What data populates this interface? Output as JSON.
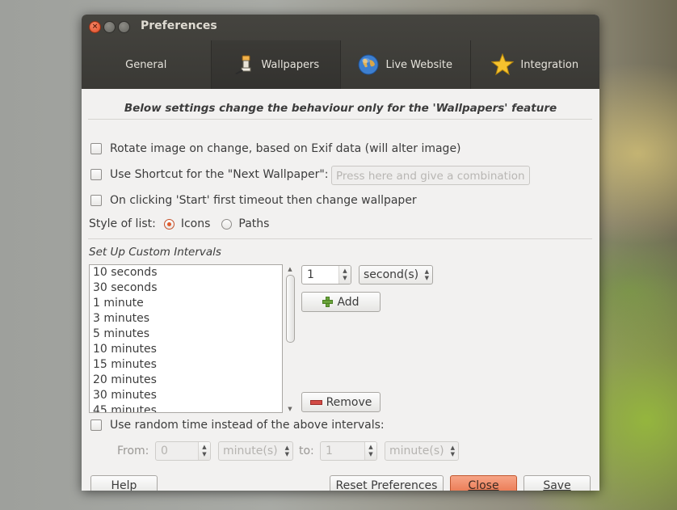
{
  "window": {
    "title": "Preferences"
  },
  "tabs": [
    {
      "label": "General",
      "icon": "none"
    },
    {
      "label": "Wallpapers",
      "icon": "paintbrush-icon"
    },
    {
      "label": "Live Website",
      "icon": "globe-icon"
    },
    {
      "label": "Integration",
      "icon": "star-icon"
    }
  ],
  "heading": "Below settings change the behaviour only for the 'Wallpapers' feature",
  "options": {
    "rotate_exif": "Rotate image on change, based on Exif data (will alter image)",
    "shortcut_label": "Use Shortcut for the \"Next Wallpaper\":",
    "shortcut_placeholder": "Press here and give a combination",
    "timeout_first": "On clicking 'Start' first timeout then change wallpaper"
  },
  "style_of_list": {
    "label": "Style of list:",
    "options": [
      "Icons",
      "Paths"
    ],
    "selected": "Icons"
  },
  "intervals": {
    "section_title": "Set Up Custom Intervals",
    "items": [
      "10 seconds",
      "30 seconds",
      "1 minute",
      "3 minutes",
      "5 minutes",
      "10 minutes",
      "15 minutes",
      "20 minutes",
      "30 minutes",
      "45 minutes"
    ],
    "amount": "1",
    "unit": "second(s)",
    "add_label": "Add",
    "remove_label": "Remove"
  },
  "random": {
    "label": "Use random time instead of the above intervals:",
    "from_label": "From:",
    "from_value": "0",
    "from_unit": "minute(s)",
    "to_label": "to:",
    "to_value": "1",
    "to_unit": "minute(s)"
  },
  "buttons": {
    "help": "Help",
    "reset": "Reset Preferences",
    "close": "Close",
    "save": "Save"
  },
  "colors": {
    "accent": "#e8754d",
    "titlebar": "#3c3b37"
  }
}
